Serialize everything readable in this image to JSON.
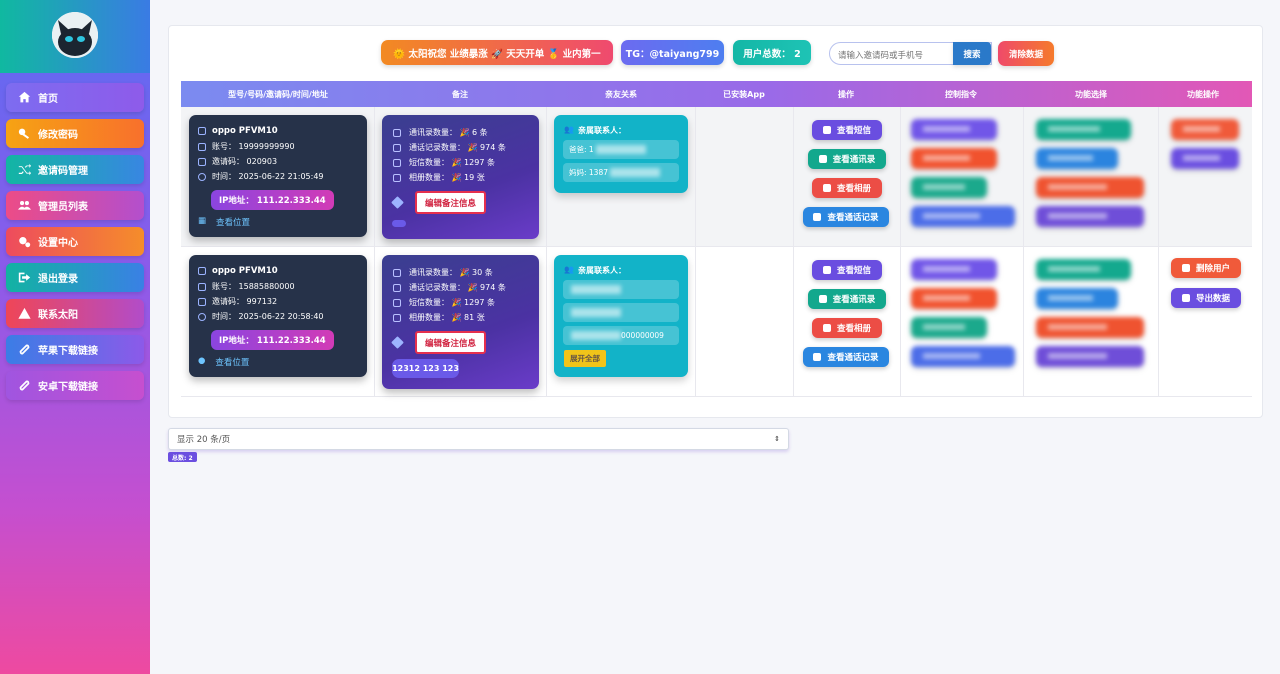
{
  "sidebar": {
    "items": [
      {
        "label": "首页",
        "icon": "home-icon",
        "colors": [
          "#7d6cf0",
          "#8e5bea"
        ]
      },
      {
        "label": "修改密码",
        "icon": "key-icon",
        "colors": [
          "#f6a313",
          "#f8702c"
        ]
      },
      {
        "label": "邀请码管理",
        "icon": "shuffle-icon",
        "colors": [
          "#12b6a3",
          "#3886e2"
        ]
      },
      {
        "label": "管理员列表",
        "icon": "users-icon",
        "colors": [
          "#ec4c87",
          "#b34fcd"
        ]
      },
      {
        "label": "设置中心",
        "icon": "gears-icon",
        "colors": [
          "#ee4b5e",
          "#f58d2a"
        ]
      },
      {
        "label": "退出登录",
        "icon": "logout-icon",
        "colors": [
          "#12b3a2",
          "#3a80e5"
        ]
      },
      {
        "label": "联系太阳",
        "icon": "warning-icon",
        "colors": [
          "#ef4657",
          "#b24cc9"
        ]
      },
      {
        "label": "苹果下载链接",
        "icon": "link-icon",
        "colors": [
          "#3b7de6",
          "#8c5ae9"
        ]
      },
      {
        "label": "安卓下载链接",
        "icon": "link-icon",
        "colors": [
          "#a055e0",
          "#c64fcf"
        ]
      }
    ]
  },
  "header": {
    "slogan": "🌞 太阳祝您 业绩暴涨 🚀 天天开单 🥇 业内第一",
    "tg": "TG：@taiyang799",
    "user_total": "用户总数： 2",
    "search_placeholder": "请输入邀请码或手机号",
    "search_button": "搜索",
    "clear_button": "清除数据"
  },
  "table": {
    "columns": [
      "型号/号码/邀请码/时间/地址",
      "备注",
      "亲友关系",
      "已安装App",
      "操作",
      "控制指令",
      "功能选择",
      "功能操作"
    ],
    "rows": [
      {
        "device": "oppo PFVM10",
        "account": "账号： 19999999990",
        "invite": "邀请码： 020903",
        "time": "时间： 2025-06-22 21:05:49",
        "ip": "IP地址： 111.22.333.44",
        "location": "查看位置",
        "stats": [
          "通讯录数量： 🎉 6 条",
          "通话记录数量： 🎉 974 条",
          "短信数量： 🎉 1297 条",
          "相册数量： 🎉 19 张"
        ],
        "edit_note": "编辑备注信息",
        "tag": "",
        "rel_title": "亲属联系人：",
        "relatives": [
          "爸爸: 1",
          "妈妈: 1387"
        ],
        "expand": ""
      },
      {
        "device": "oppo PFVM10",
        "account": "账号： 15885880000",
        "invite": "邀请码： 997132",
        "time": "时间： 2025-06-22 20:58:40",
        "ip": "IP地址： 111.22.333.44",
        "location": "查看位置",
        "stats": [
          "通讯录数量： 🎉 30 条",
          "通话记录数量： 🎉 974 条",
          "短信数量： 🎉 1297 条",
          "相册数量： 🎉 81 张"
        ],
        "edit_note": "编辑备注信息",
        "tag": "12312 123 123",
        "rel_title": "亲属联系人：",
        "relatives": [
          "",
          "",
          "000000009"
        ],
        "expand": "展开全部"
      }
    ],
    "actions": [
      "查看短信",
      "查看通讯录",
      "查看相册",
      "查看通话记录"
    ],
    "user_actions": [
      "删除用户",
      "导出数据"
    ]
  },
  "footer": {
    "page_size": "显示 20 条/页",
    "total_badge": "总数: 2"
  }
}
